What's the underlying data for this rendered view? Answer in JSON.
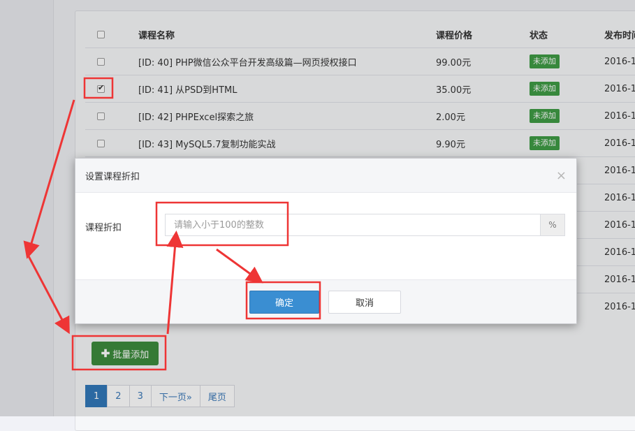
{
  "table": {
    "headers": [
      "课程名称",
      "课程价格",
      "状态",
      "发布时间"
    ],
    "rows": [
      {
        "name": "[ID: 40] PHP微信公众平台开发高级篇—网页授权接口",
        "price": "99.00元",
        "status": "未添加",
        "date": "2016-1",
        "checked": false
      },
      {
        "name": "[ID: 41] 从PSD到HTML",
        "price": "35.00元",
        "status": "未添加",
        "date": "2016-1",
        "checked": true
      },
      {
        "name": "[ID: 42] PHPExcel探索之旅",
        "price": "2.00元",
        "status": "未添加",
        "date": "2016-1",
        "checked": false
      },
      {
        "name": "[ID: 43] MySQL5.7复制功能实战",
        "price": "9.90元",
        "status": "未添加",
        "date": "2016-1",
        "checked": false
      },
      {
        "name": "",
        "price": "",
        "status": "",
        "date": "2016-1",
        "checked": false
      },
      {
        "name": "",
        "price": "",
        "status": "",
        "date": "2016-1",
        "checked": false
      },
      {
        "name": "",
        "price": "",
        "status": "",
        "date": "2016-1",
        "checked": false
      },
      {
        "name": "",
        "price": "",
        "status": "",
        "date": "2016-1",
        "checked": false
      },
      {
        "name": "",
        "price": "",
        "status": "",
        "date": "2016-1",
        "checked": false
      },
      {
        "name": "",
        "price": "",
        "status": "",
        "date": "2016-1",
        "checked": false
      }
    ]
  },
  "batch_button": {
    "icon": "plus-icon",
    "label": "批量添加"
  },
  "pagination": {
    "pages": [
      "1",
      "2",
      "3"
    ],
    "next_label": "下一页»",
    "last_label": "尾页",
    "current": "1"
  },
  "modal": {
    "title": "设置课程折扣",
    "close_glyph": "×",
    "field_label": "课程折扣",
    "input_placeholder": "请输入小于100的整数",
    "input_value": "",
    "addon": "%",
    "ok_label": "确定",
    "cancel_label": "取消"
  },
  "colors": {
    "badge": "#3f9b45",
    "batch_button": "#3d8b3d",
    "primary": "#3a8ed2",
    "page_active": "#3178b9",
    "annotation": "#ee3535"
  }
}
